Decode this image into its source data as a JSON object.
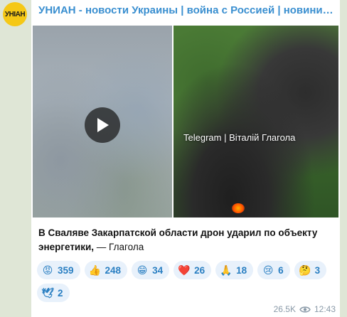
{
  "avatar": {
    "text": "УНІАН",
    "color": "#f5c816"
  },
  "channel": {
    "title": "УНИАН - новости Украины | война с Россией | новини Україні...",
    "color": "#3a8fd0"
  },
  "media": {
    "video": {
      "icon": "play-icon"
    },
    "photo": {
      "watermark": "Telegram | Віталій Глагола"
    }
  },
  "post": {
    "headline": "В Сваляве Закарпатской области дрон ударил по объекту энергетики,",
    "source": " — Глагола"
  },
  "reactions": [
    {
      "emoji": "😡",
      "icon": "angry-face-icon",
      "count": "359"
    },
    {
      "emoji": "👍",
      "icon": "thumbs-up-icon",
      "count": "248"
    },
    {
      "emoji": "😁",
      "icon": "grinning-face-icon",
      "count": "34"
    },
    {
      "emoji": "❤️",
      "icon": "heart-icon",
      "count": "26"
    },
    {
      "emoji": "🙏",
      "icon": "praying-hands-icon",
      "count": "18"
    },
    {
      "emoji": "😢",
      "icon": "crying-face-icon",
      "count": "6"
    },
    {
      "emoji": "🤔",
      "icon": "thinking-face-icon",
      "count": "3"
    },
    {
      "emoji": "🕊",
      "icon": "dove-icon",
      "count": "2"
    }
  ],
  "meta": {
    "views": "26.5K",
    "time": "12:43",
    "icon": "eye-icon"
  }
}
